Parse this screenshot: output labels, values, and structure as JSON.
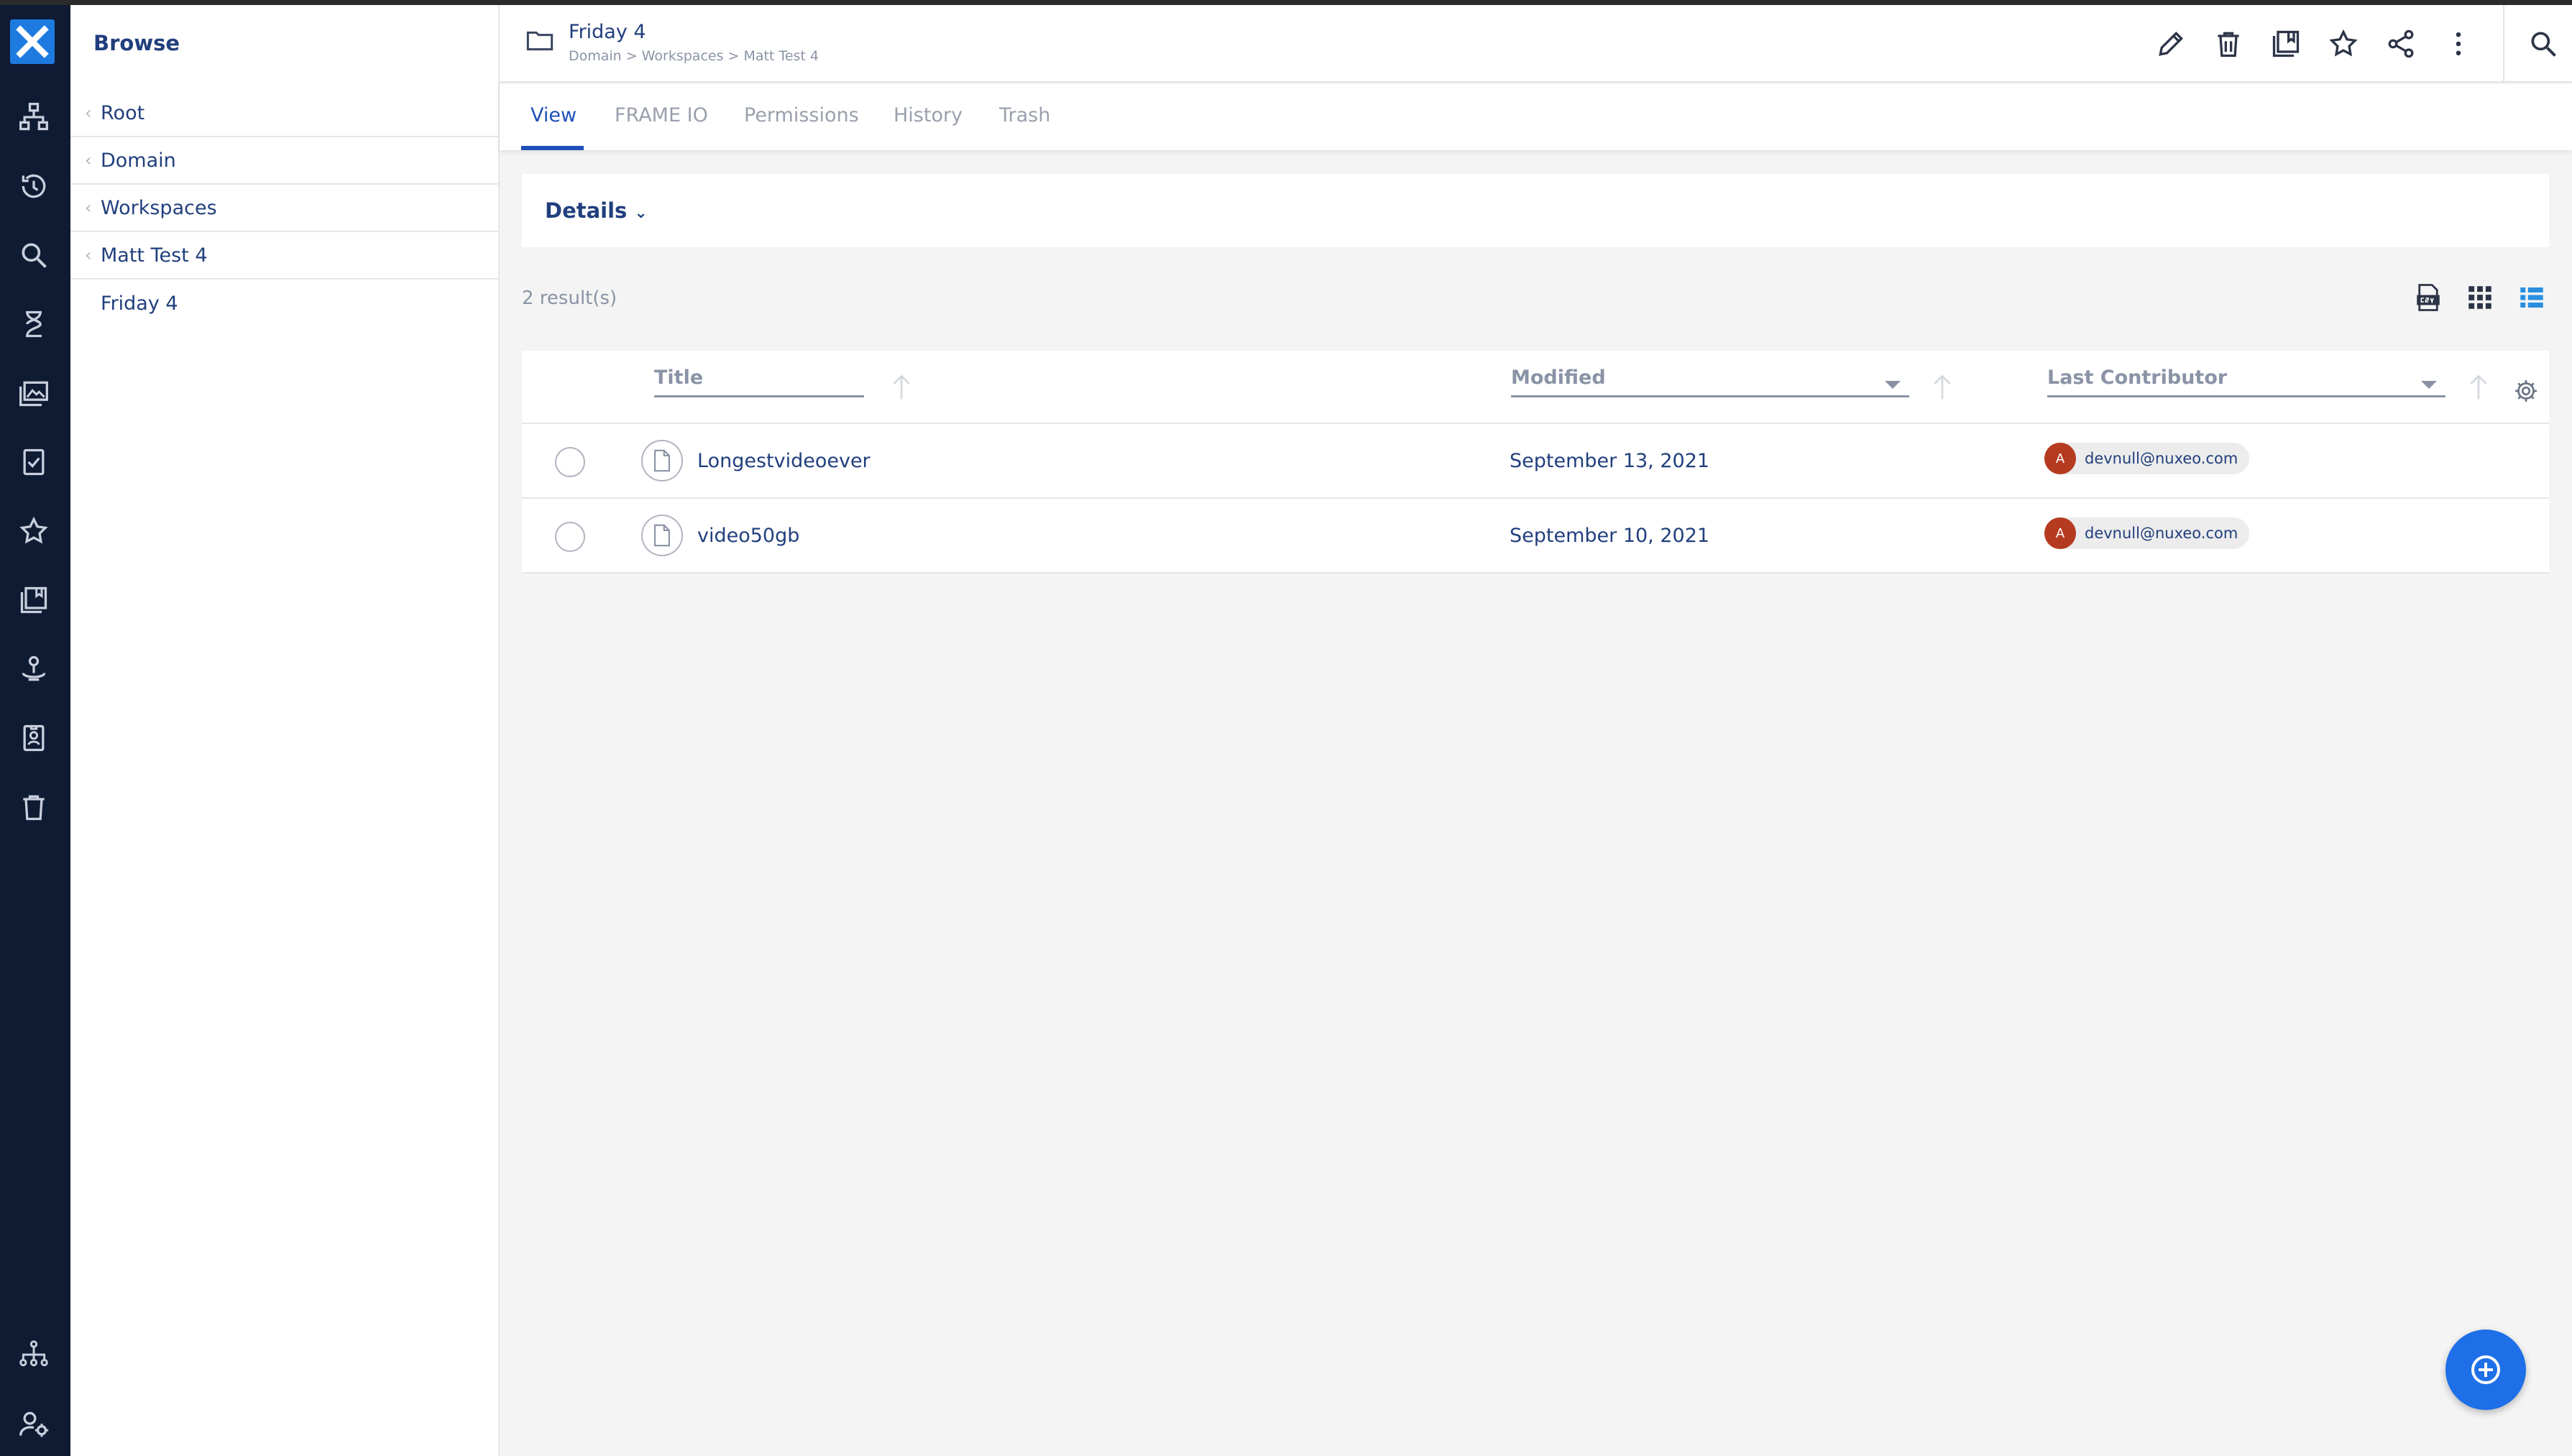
{
  "browse": {
    "heading": "Browse",
    "tree": [
      "Root",
      "Domain",
      "Workspaces",
      "Matt Test 4"
    ],
    "current": "Friday 4"
  },
  "header": {
    "title": "Friday 4",
    "breadcrumb": "Domain > Workspaces > Matt Test 4"
  },
  "tabs": [
    "View",
    "FRAME IO",
    "Permissions",
    "History",
    "Trash"
  ],
  "active_tab": "View",
  "details": {
    "label": "Details"
  },
  "results": {
    "count_text": "2 result(s)"
  },
  "table": {
    "columns": {
      "title": "Title",
      "modified": "Modified",
      "contributor": "Last Contributor"
    },
    "rows": [
      {
        "title": "Longestvideoever",
        "modified": "September 13, 2021",
        "avatar": "A",
        "contributor": "devnull@nuxeo.com"
      },
      {
        "title": "video50gb",
        "modified": "September 10, 2021",
        "avatar": "A",
        "contributor": "devnull@nuxeo.com"
      }
    ]
  },
  "icons": {
    "rail": [
      "logo-icon",
      "browse-icon",
      "history-icon",
      "search-icon",
      "tasks-icon",
      "collections-icon",
      "clipboard-check-icon",
      "favorites-icon",
      "clipboard-icon",
      "personal-workspace-icon",
      "id-badge-icon",
      "trash-icon",
      "sitemap-icon",
      "admin-user-icon"
    ],
    "actions": [
      "edit-icon",
      "delete-icon",
      "add-to-collection-icon",
      "favorite-icon",
      "share-icon",
      "more-icon",
      "search-icon"
    ]
  },
  "colors": {
    "rail_bg": "#0f1a33",
    "accent": "#1e4fb8",
    "fab": "#1e6fe8",
    "avatar": "#b53b20"
  }
}
